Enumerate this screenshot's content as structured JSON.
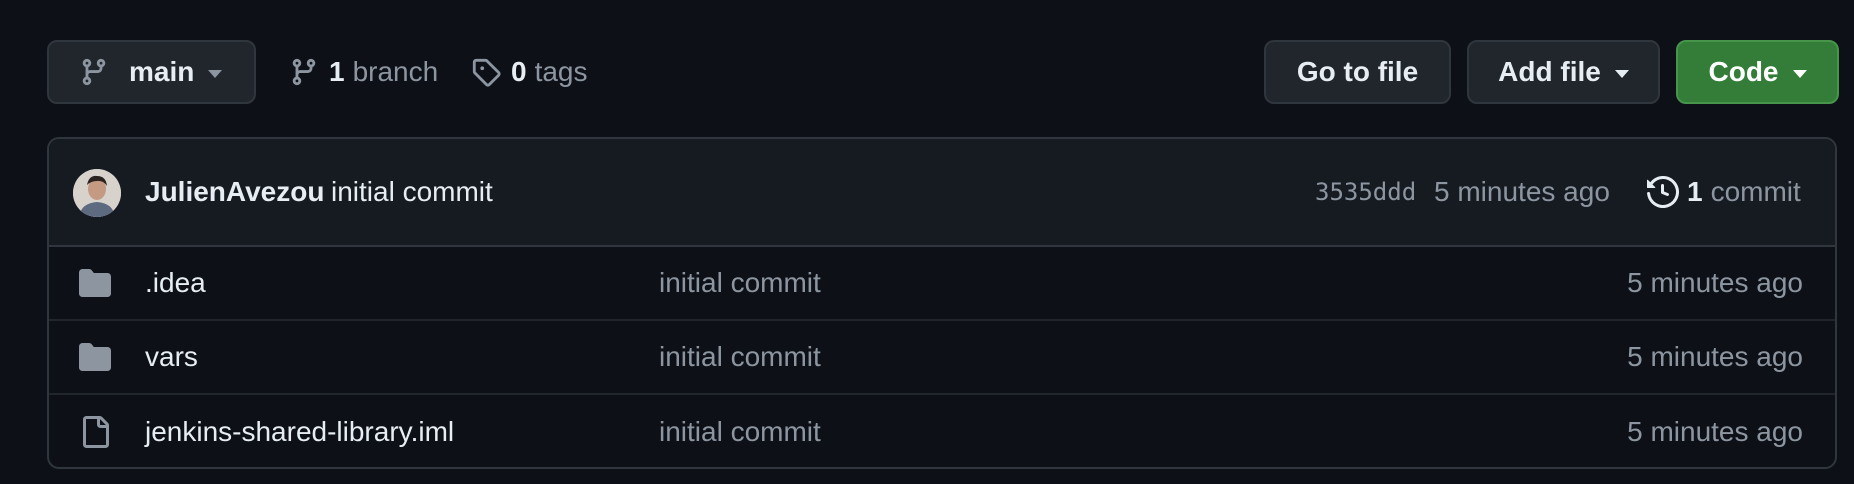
{
  "toolbar": {
    "branch_name": "main",
    "branch_count": "1",
    "branch_label": "branch",
    "tag_count": "0",
    "tag_label": "tags",
    "goto_file": "Go to file",
    "add_file": "Add file",
    "code": "Code"
  },
  "commit": {
    "author": "JulienAvezou",
    "message": "initial commit",
    "sha": "3535ddd",
    "time": "5 minutes ago",
    "commit_count": "1",
    "commit_label": "commit"
  },
  "files": [
    {
      "type": "folder-icon",
      "name": ".idea",
      "message": "initial commit",
      "time": "5 minutes ago"
    },
    {
      "type": "folder-icon",
      "name": "vars",
      "message": "initial commit",
      "time": "5 minutes ago"
    },
    {
      "type": "file-icon",
      "name": "jenkins-shared-library.iml",
      "message": "initial commit",
      "time": "5 minutes ago"
    }
  ],
  "colors": {
    "background": "#0d1117",
    "code_button": "#347d39",
    "border": "#30363d",
    "muted_text": "#8d96a0"
  }
}
